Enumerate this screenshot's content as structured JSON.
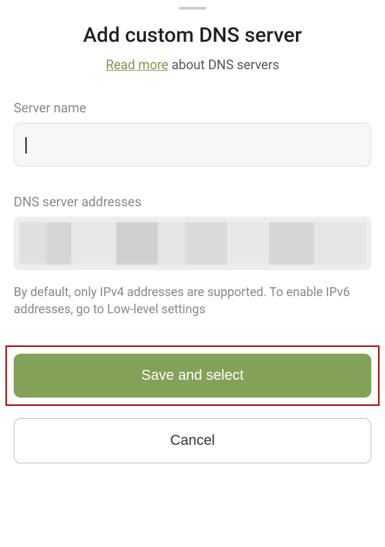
{
  "title": "Add custom DNS server",
  "subtitle": {
    "link_text": "Read more",
    "rest_text": " about DNS servers"
  },
  "server_name": {
    "label": "Server name",
    "value": ""
  },
  "addresses": {
    "label": "DNS server addresses"
  },
  "hint": "By default, only IPv4 addresses are supported. To enable IPv6 addresses, go to Low-level settings",
  "buttons": {
    "save": "Save and select",
    "cancel": "Cancel"
  }
}
